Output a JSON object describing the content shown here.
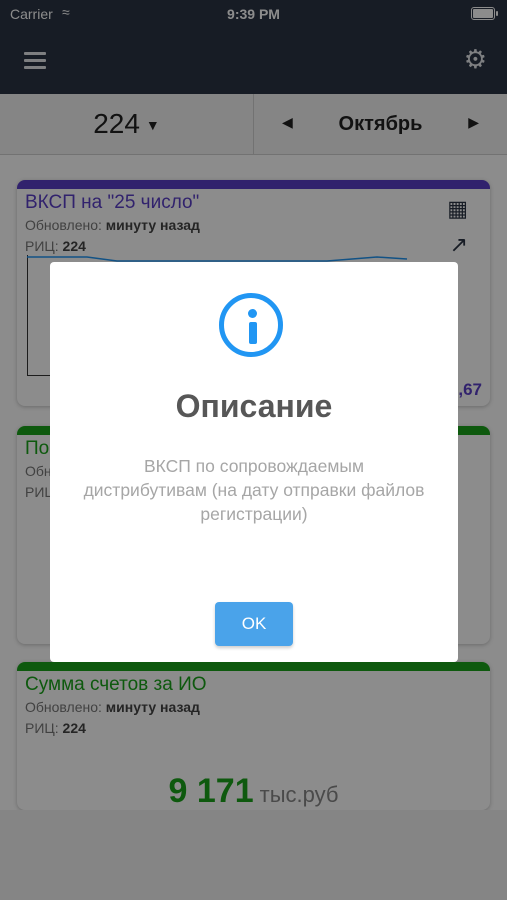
{
  "status_bar": {
    "carrier": "Carrier",
    "time": "9:39 PM"
  },
  "selector": {
    "rits": "224",
    "month": "Октябрь"
  },
  "cards": [
    {
      "title": "ВКСП на \"25 число\"",
      "updated_label": "Обновлено:",
      "updated_value": "минуту назад",
      "rits_label": "РИЦ:",
      "rits_value": "224",
      "value": ",67"
    },
    {
      "title": "По",
      "updated_label": "Обно",
      "rits_label": "РИЦ"
    },
    {
      "title": "Сумма счетов за ИО",
      "updated_label": "Обновлено:",
      "updated_value": "минуту назад",
      "rits_label": "РИЦ:",
      "rits_value": "224",
      "amount": "9 171",
      "unit": "тыс.руб"
    }
  ],
  "dialog": {
    "title": "Описание",
    "text": "ВКСП по сопровождаемым дистрибутивам (на дату отправки файлов регистрации)",
    "ok_label": "OK"
  },
  "colors": {
    "accent_purple": "#5a3fc6",
    "accent_green": "#1aa31a",
    "dialog_button": "#4aa3ea",
    "info_icon": "#2196f3"
  }
}
